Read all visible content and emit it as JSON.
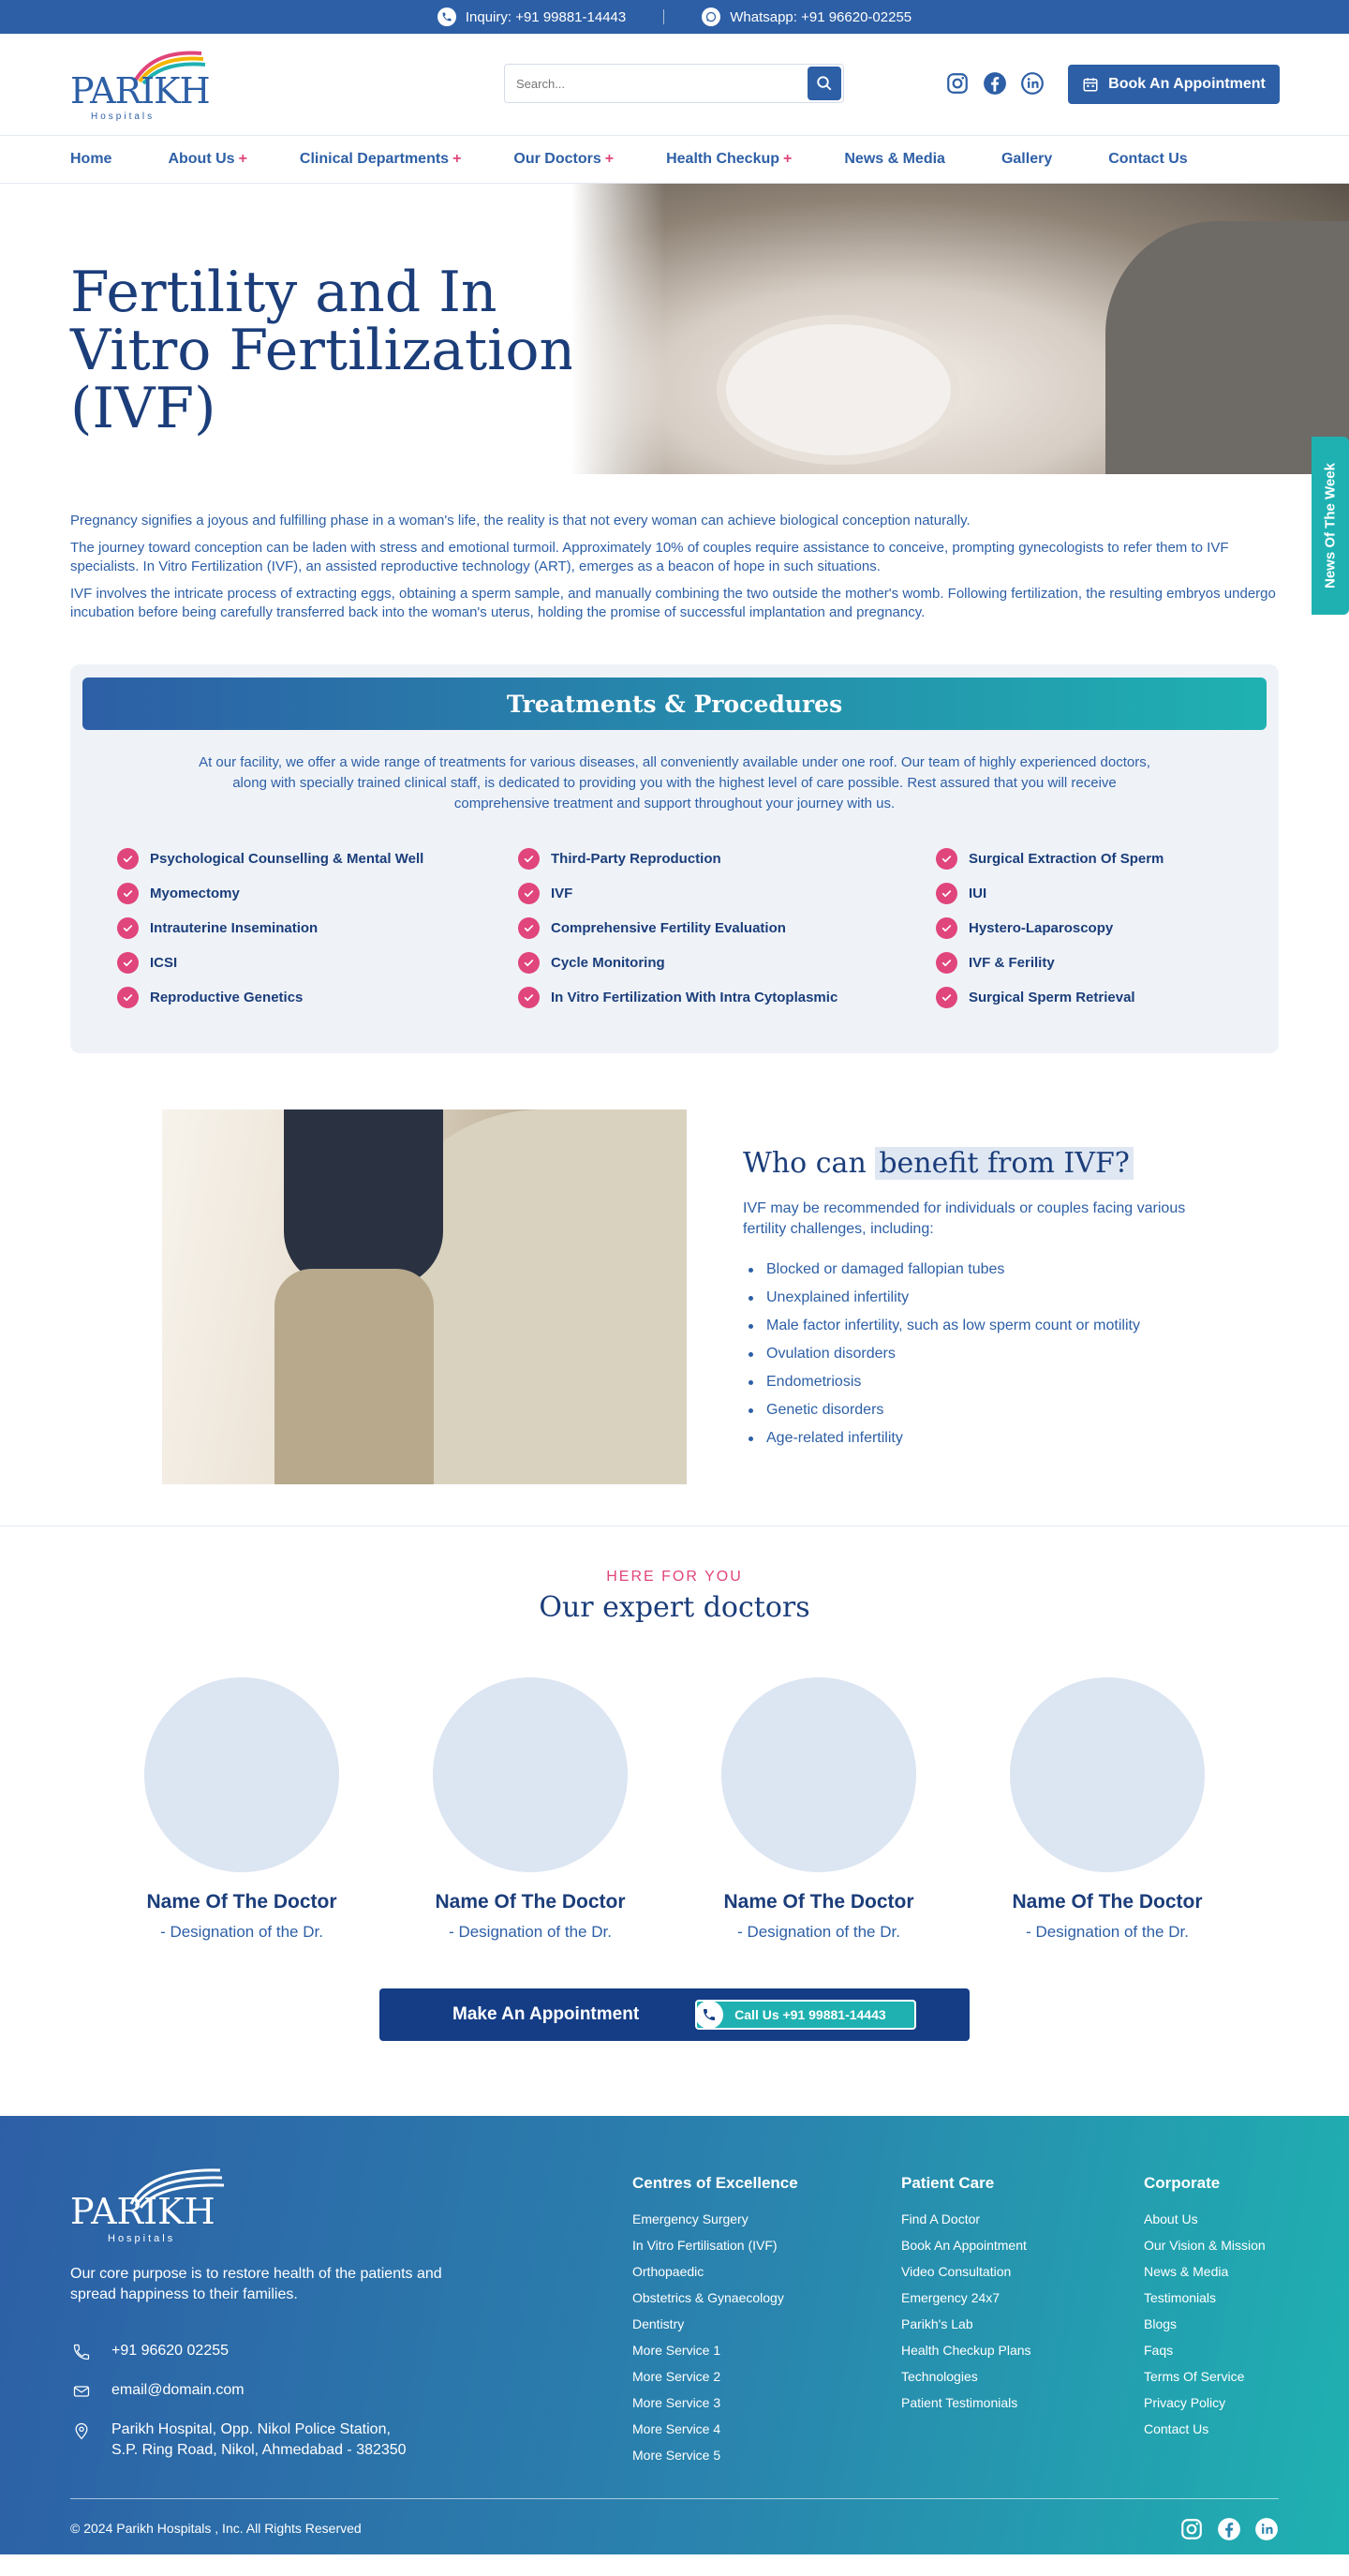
{
  "topbar": {
    "inquiry": "Inquiry: +91 99881-14443",
    "whatsapp": "Whatsapp: +91 96620-02255"
  },
  "header": {
    "logo_text": "PARIKH",
    "logo_sub": "Hospitals",
    "search_placeholder": "Search...",
    "book_label": "Book An Appointment",
    "socials": [
      "instagram-icon",
      "facebook-icon",
      "linkedin-icon"
    ]
  },
  "nav": {
    "items": [
      {
        "label": "Home",
        "plus": ""
      },
      {
        "label": "About Us",
        "plus": "+"
      },
      {
        "label": "Clinical Departments",
        "plus": "+"
      },
      {
        "label": "Our Doctors",
        "plus": "+"
      },
      {
        "label": "Health Checkup",
        "plus": "+"
      },
      {
        "label": "News & Media",
        "plus": ""
      },
      {
        "label": "Gallery",
        "plus": ""
      },
      {
        "label": "Contact Us",
        "plus": ""
      }
    ]
  },
  "hero": {
    "title": "Fertility and In Vitro Fertilization (IVF)"
  },
  "side_tab": "News Of The Week",
  "intro": [
    "Pregnancy signifies a joyous and fulfilling phase in a woman's life, the reality is that not every woman can achieve biological conception naturally.",
    "The journey toward conception can be laden with stress and emotional turmoil. Approximately 10% of couples require assistance to conceive, prompting gynecologists to refer them to IVF specialists. In Vitro Fertilization (IVF), an assisted reproductive technology (ART), emerges as a beacon of hope in such situations.",
    "IVF involves the intricate process of extracting eggs, obtaining a sperm sample, and manually combining the two outside the mother's womb. Following fertilization, the resulting embryos undergo incubation before being carefully transferred back into the woman's uterus, holding the promise of successful implantation and pregnancy."
  ],
  "treatments": {
    "title": "Treatments & Procedures",
    "description": "At our facility, we offer a wide range of treatments for various diseases, all conveniently available under one roof. Our team of highly experienced doctors, along with specially trained clinical staff, is dedicated to providing you with the highest level of care possible. Rest assured that you will receive comprehensive treatment and support throughout your journey with us.",
    "items": [
      "Psychological Counselling & Mental Well",
      "Third-Party Reproduction",
      "Surgical Extraction Of Sperm",
      "Myomectomy",
      "IVF",
      "IUI",
      "Intrauterine Insemination",
      "Comprehensive Fertility Evaluation",
      "Hystero-Laparoscopy",
      "ICSI",
      "Cycle Monitoring",
      "IVF & Ferility",
      "Reproductive Genetics",
      "In Vitro Fertilization With Intra Cytoplasmic",
      "Surgical Sperm Retrieval"
    ]
  },
  "benefit": {
    "title_plain": "Who can ",
    "title_highlight": "benefit from IVF?",
    "lead": "IVF may be recommended for individuals or couples facing various fertility challenges, including:",
    "items": [
      "Blocked or damaged fallopian tubes",
      "Unexplained infertility",
      "Male factor infertility, such as low sperm count or motility",
      "Ovulation disorders",
      "Endometriosis",
      "Genetic disorders",
      "Age-related infertility"
    ]
  },
  "doctors": {
    "eyebrow": "HERE FOR YOU",
    "title": "Our expert doctors",
    "list": [
      {
        "name": "Name Of The Doctor",
        "designation": "- Designation of the Dr."
      },
      {
        "name": "Name Of The Doctor",
        "designation": "- Designation of the Dr."
      },
      {
        "name": "Name Of The Doctor",
        "designation": "- Designation of the Dr."
      },
      {
        "name": "Name Of The Doctor",
        "designation": "- Designation of the Dr."
      }
    ],
    "appointment_label": "Make An Appointment",
    "call_label": "Call Us +91 99881-14443"
  },
  "footer": {
    "logo_text": "PARIKH",
    "logo_sub": "Hospitals",
    "purpose": "Our core purpose is to restore health of the patients and spread happiness to their families.",
    "phone": "+91 96620 02255",
    "email": "email@domain.com",
    "address_line1": "Parikh Hospital, Opp. Nikol Police Station,",
    "address_line2": "S.P. Ring Road, Nikol, Ahmedabad - 382350",
    "columns": [
      {
        "title": "Centres of Excellence",
        "links": [
          "Emergency Surgery",
          "In Vitro Fertilisation (IVF)",
          "Orthopaedic",
          "Obstetrics & Gynaecology",
          "Dentistry",
          "More Service 1",
          "More Service 2",
          "More Service 3",
          "More Service 4",
          "More Service 5"
        ]
      },
      {
        "title": "Patient Care",
        "links": [
          "Find A Doctor",
          "Book An Appointment",
          "Video Consultation",
          "Emergency 24x7",
          "Parikh's Lab",
          "Health Checkup Plans",
          "Technologies",
          "Patient Testimonials"
        ]
      },
      {
        "title": "Corporate",
        "links": [
          "About Us",
          "Our Vision & Mission",
          "News & Media",
          "Testimonials",
          "Blogs",
          "Faqs",
          "Terms Of Service",
          "Privacy Policy",
          "Contact Us"
        ]
      }
    ],
    "copyright": "© 2024 Parikh Hospitals , Inc. All Rights Reserved"
  },
  "colors": {
    "primary": "#2d5fa6",
    "dark": "#1b3d7a",
    "accent_pink": "#e0457b",
    "teal": "#1fb1b1"
  }
}
